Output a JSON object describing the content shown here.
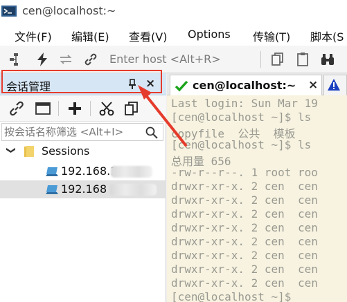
{
  "window": {
    "title": "cen@localhost:~"
  },
  "menu": [
    "文件(F)",
    "编辑(E)",
    "查看(V)",
    "Options",
    "传输(T)",
    "脚本(S"
  ],
  "toolbar": {
    "enter_host_placeholder": "Enter host <Alt+R>"
  },
  "session_panel": {
    "title": "会话管理",
    "close_label": "×",
    "filter_placeholder": "按会话名称筛选 <Alt+I>",
    "tree": {
      "root": {
        "caret": "❯",
        "label": "Sessions"
      },
      "hosts": [
        {
          "label": "192.168.1"
        },
        {
          "label": "192.168"
        }
      ]
    }
  },
  "tabs": {
    "active_label": "cen@localhost:~",
    "close_label": "×"
  },
  "terminal": {
    "lines": [
      "Last login: Sun Mar 19",
      "[cen@localhost ~]$ ls",
      "copyfile  公共  模板",
      "[cen@localhost ~]$ ls",
      "总用量 656",
      "-rw-r--r--. 1 root roo",
      "drwxr-xr-x. 2 cen  cen",
      "drwxr-xr-x. 2 cen  cen",
      "drwxr-xr-x. 2 cen  cen",
      "drwxr-xr-x. 2 cen  cen",
      "drwxr-xr-x. 2 cen  cen",
      "drwxr-xr-x. 2 cen  cen",
      "drwxr-xr-x. 2 cen  cen",
      "drwxr-xr-x. 2 cen  cen",
      "[cen@localhost ~]$"
    ]
  },
  "colors": {
    "annotation": "#e53b2c",
    "terminal_bg": "#f7f3e0",
    "panel_header": "#d6e6f5",
    "check": "#1aa31a"
  }
}
